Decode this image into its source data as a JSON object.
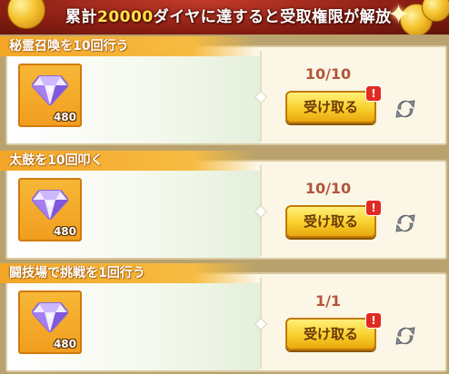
{
  "banner": {
    "prefix": "累計",
    "amount": "20000",
    "suffix": "ダイヤに達すると受取権限が解放"
  },
  "missions": [
    {
      "title": "秘霊召喚を10回行う",
      "progress": "10/10",
      "reward_count": "480",
      "claim_label": "受け取る",
      "badge": "!"
    },
    {
      "title": "太鼓を10回叩く",
      "progress": "10/10",
      "reward_count": "480",
      "claim_label": "受け取る",
      "badge": "!"
    },
    {
      "title": "闘技場で挑戦を1回行う",
      "progress": "1/1",
      "reward_count": "480",
      "claim_label": "受け取る",
      "badge": "!"
    }
  ],
  "icons": {
    "reward": "diamond-gem-icon",
    "refresh": "refresh-icon",
    "alert": "alert-badge-icon"
  },
  "colors": {
    "accent": "#f3a626",
    "progress_text": "#b3553a",
    "button_gold": "#f9cf2b",
    "badge_red": "#e12b22"
  }
}
